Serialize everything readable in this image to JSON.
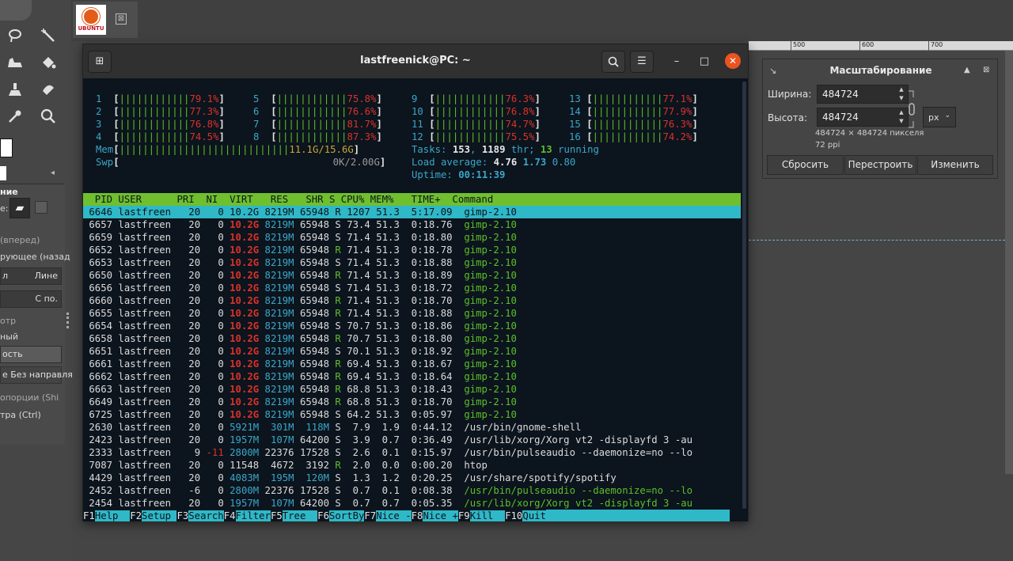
{
  "gimp": {
    "tool_options": {
      "title": "ние",
      "mode_label": "е:",
      "lines": [
        "(вперед)",
        "рующее (назад",
        "отр",
        "ный",
        "ость",
        "опорции (Shi",
        "тра (Ctrl)"
      ],
      "box1_left": "л",
      "box1_right": "Лине",
      "box2_right": "С по.",
      "box3_text": "е Без направля"
    },
    "image_tab": {
      "thumb_text": "UBUNTU",
      "close": "⊠"
    },
    "ruler": [
      "500",
      "600",
      "700"
    ]
  },
  "scale_dialog": {
    "title": "Масштабирование",
    "width_label": "Ширина:",
    "width_value": "484724",
    "height_label": "Высота:",
    "height_value": "484724",
    "unit": "px",
    "size_info": "484724 × 484724 пикселя",
    "resolution_info": "72 ppi",
    "reset_button": "Сбросить",
    "rebuild_button": "Перестроить",
    "change_button": "Изменить"
  },
  "terminal": {
    "title": "lastfreenick@PC: ~",
    "cpus": [
      {
        "n": "1",
        "bar": "||||||||||||",
        "pct": "79.1%"
      },
      {
        "n": "2",
        "bar": "||||||||||||",
        "pct": "77.3%"
      },
      {
        "n": "3",
        "bar": "||||||||||||",
        "pct": "76.8%"
      },
      {
        "n": "4",
        "bar": "||||||||||||",
        "pct": "74.5%"
      },
      {
        "n": "5",
        "bar": "||||||||||||",
        "pct": "75.8%"
      },
      {
        "n": "6",
        "bar": "||||||||||||",
        "pct": "76.6%"
      },
      {
        "n": "7",
        "bar": "||||||||||||",
        "pct": "81.7%"
      },
      {
        "n": "8",
        "bar": "||||||||||||",
        "pct": "87.3%"
      },
      {
        "n": "9",
        "bar": "||||||||||||",
        "pct": "76.3%"
      },
      {
        "n": "10",
        "bar": "||||||||||||",
        "pct": "76.8%"
      },
      {
        "n": "11",
        "bar": "||||||||||||",
        "pct": "74.7%"
      },
      {
        "n": "12",
        "bar": "||||||||||||",
        "pct": "75.5%"
      },
      {
        "n": "13",
        "bar": "||||||||||||",
        "pct": "77.1%"
      },
      {
        "n": "14",
        "bar": "||||||||||||",
        "pct": "77.9%"
      },
      {
        "n": "15",
        "bar": "||||||||||||",
        "pct": "76.3%"
      },
      {
        "n": "16",
        "bar": "||||||||||||",
        "pct": "74.2%"
      }
    ],
    "mem_label": "Mem",
    "mem_bar": "|||||||||||||||||||||||||||||",
    "mem_value": "11.1G/15.6G",
    "swp_label": "Swp",
    "swp_value": "0K/2.00G",
    "tasks_label": "Tasks: ",
    "tasks_total": "153",
    "tasks_thr": "1189",
    "tasks_running": "13",
    "load_label": "Load average: ",
    "load1": "4.76",
    "load5": "1.73",
    "load15": "0.80",
    "uptime_label": "Uptime: ",
    "uptime": "00:11:39",
    "header": "  PID USER      PRI  NI  VIRT   RES   SHR S CPU% MEM%   TIME+  Command",
    "processes": [
      {
        "pid": "6646",
        "user": "lastfreen",
        "pri": "20",
        "ni": "0",
        "virt": "10.2G",
        "res": "8219M",
        "shr": "65948",
        "s": "R",
        "cpu": "1207",
        "mem": "51.3",
        "time": "5:17.09",
        "cmd": "gimp-2.10",
        "selected": true
      },
      {
        "pid": "6657",
        "user": "lastfreen",
        "pri": "20",
        "ni": "0",
        "virt": "10.2G",
        "res": "8219M",
        "shr": "65948",
        "s": "S",
        "cpu": "73.4",
        "mem": "51.3",
        "time": "0:18.76",
        "cmd": "gimp-2.10"
      },
      {
        "pid": "6659",
        "user": "lastfreen",
        "pri": "20",
        "ni": "0",
        "virt": "10.2G",
        "res": "8219M",
        "shr": "65948",
        "s": "S",
        "cpu": "71.4",
        "mem": "51.3",
        "time": "0:18.80",
        "cmd": "gimp-2.10"
      },
      {
        "pid": "6652",
        "user": "lastfreen",
        "pri": "20",
        "ni": "0",
        "virt": "10.2G",
        "res": "8219M",
        "shr": "65948",
        "s": "R",
        "cpu": "71.4",
        "mem": "51.3",
        "time": "0:18.78",
        "cmd": "gimp-2.10"
      },
      {
        "pid": "6653",
        "user": "lastfreen",
        "pri": "20",
        "ni": "0",
        "virt": "10.2G",
        "res": "8219M",
        "shr": "65948",
        "s": "S",
        "cpu": "71.4",
        "mem": "51.3",
        "time": "0:18.88",
        "cmd": "gimp-2.10"
      },
      {
        "pid": "6650",
        "user": "lastfreen",
        "pri": "20",
        "ni": "0",
        "virt": "10.2G",
        "res": "8219M",
        "shr": "65948",
        "s": "R",
        "cpu": "71.4",
        "mem": "51.3",
        "time": "0:18.89",
        "cmd": "gimp-2.10"
      },
      {
        "pid": "6656",
        "user": "lastfreen",
        "pri": "20",
        "ni": "0",
        "virt": "10.2G",
        "res": "8219M",
        "shr": "65948",
        "s": "S",
        "cpu": "71.4",
        "mem": "51.3",
        "time": "0:18.72",
        "cmd": "gimp-2.10"
      },
      {
        "pid": "6660",
        "user": "lastfreen",
        "pri": "20",
        "ni": "0",
        "virt": "10.2G",
        "res": "8219M",
        "shr": "65948",
        "s": "R",
        "cpu": "71.4",
        "mem": "51.3",
        "time": "0:18.70",
        "cmd": "gimp-2.10"
      },
      {
        "pid": "6655",
        "user": "lastfreen",
        "pri": "20",
        "ni": "0",
        "virt": "10.2G",
        "res": "8219M",
        "shr": "65948",
        "s": "R",
        "cpu": "71.4",
        "mem": "51.3",
        "time": "0:18.88",
        "cmd": "gimp-2.10"
      },
      {
        "pid": "6654",
        "user": "lastfreen",
        "pri": "20",
        "ni": "0",
        "virt": "10.2G",
        "res": "8219M",
        "shr": "65948",
        "s": "S",
        "cpu": "70.7",
        "mem": "51.3",
        "time": "0:18.86",
        "cmd": "gimp-2.10"
      },
      {
        "pid": "6658",
        "user": "lastfreen",
        "pri": "20",
        "ni": "0",
        "virt": "10.2G",
        "res": "8219M",
        "shr": "65948",
        "s": "R",
        "cpu": "70.7",
        "mem": "51.3",
        "time": "0:18.80",
        "cmd": "gimp-2.10"
      },
      {
        "pid": "6651",
        "user": "lastfreen",
        "pri": "20",
        "ni": "0",
        "virt": "10.2G",
        "res": "8219M",
        "shr": "65948",
        "s": "S",
        "cpu": "70.1",
        "mem": "51.3",
        "time": "0:18.92",
        "cmd": "gimp-2.10"
      },
      {
        "pid": "6661",
        "user": "lastfreen",
        "pri": "20",
        "ni": "0",
        "virt": "10.2G",
        "res": "8219M",
        "shr": "65948",
        "s": "R",
        "cpu": "69.4",
        "mem": "51.3",
        "time": "0:18.67",
        "cmd": "gimp-2.10"
      },
      {
        "pid": "6662",
        "user": "lastfreen",
        "pri": "20",
        "ni": "0",
        "virt": "10.2G",
        "res": "8219M",
        "shr": "65948",
        "s": "R",
        "cpu": "69.4",
        "mem": "51.3",
        "time": "0:18.64",
        "cmd": "gimp-2.10"
      },
      {
        "pid": "6663",
        "user": "lastfreen",
        "pri": "20",
        "ni": "0",
        "virt": "10.2G",
        "res": "8219M",
        "shr": "65948",
        "s": "R",
        "cpu": "68.8",
        "mem": "51.3",
        "time": "0:18.43",
        "cmd": "gimp-2.10"
      },
      {
        "pid": "6649",
        "user": "lastfreen",
        "pri": "20",
        "ni": "0",
        "virt": "10.2G",
        "res": "8219M",
        "shr": "65948",
        "s": "R",
        "cpu": "68.8",
        "mem": "51.3",
        "time": "0:18.70",
        "cmd": "gimp-2.10"
      },
      {
        "pid": "6725",
        "user": "lastfreen",
        "pri": "20",
        "ni": "0",
        "virt": "10.2G",
        "res": "8219M",
        "shr": "65948",
        "s": "S",
        "cpu": "64.2",
        "mem": "51.3",
        "time": "0:05.97",
        "cmd": "gimp-2.10"
      },
      {
        "pid": "2630",
        "user": "lastfreen",
        "pri": "20",
        "ni": "0",
        "virt": "5921M",
        "res": "301M",
        "shr": "118M",
        "s": "S",
        "cpu": "7.9",
        "mem": "1.9",
        "time": "0:44.12",
        "cmd": "/usr/bin/gnome-shell"
      },
      {
        "pid": "2423",
        "user": "lastfreen",
        "pri": "20",
        "ni": "0",
        "virt": "1957M",
        "res": "107M",
        "shr": "64200",
        "s": "S",
        "cpu": "3.9",
        "mem": "0.7",
        "time": "0:36.49",
        "cmd": "/usr/lib/xorg/Xorg vt2 -displayfd 3 -au"
      },
      {
        "pid": "2333",
        "user": "lastfreen",
        "pri": "9",
        "ni": "-11",
        "virt": "2800M",
        "res": "22376",
        "shr": "17528",
        "s": "S",
        "cpu": "2.6",
        "mem": "0.1",
        "time": "0:15.97",
        "cmd": "/usr/bin/pulseaudio --daemonize=no --lo"
      },
      {
        "pid": "7087",
        "user": "lastfreen",
        "pri": "20",
        "ni": "0",
        "virt": "11548",
        "res": "4672",
        "shr": "3192",
        "s": "R",
        "cpu": "2.0",
        "mem": "0.0",
        "time": "0:00.20",
        "cmd": "htop"
      },
      {
        "pid": "4429",
        "user": "lastfreen",
        "pri": "20",
        "ni": "0",
        "virt": "4083M",
        "res": "195M",
        "shr": "120M",
        "s": "S",
        "cpu": "1.3",
        "mem": "1.2",
        "time": "0:20.25",
        "cmd": "/usr/share/spotify/spotify"
      },
      {
        "pid": "2452",
        "user": "lastfreen",
        "pri": "-6",
        "ni": "0",
        "virt": "2800M",
        "res": "22376",
        "shr": "17528",
        "s": "S",
        "cpu": "0.7",
        "mem": "0.1",
        "time": "0:08.38",
        "cmd": "/usr/bin/pulseaudio --daemonize=no --lo"
      },
      {
        "pid": "2454",
        "user": "lastfreen",
        "pri": "20",
        "ni": "0",
        "virt": "1957M",
        "res": "107M",
        "shr": "64200",
        "s": "S",
        "cpu": "0.7",
        "mem": "0.7",
        "time": "0:05.35",
        "cmd": "/usr/lib/xorg/Xorg vt2 -displayfd 3 -au"
      }
    ],
    "fkeys": [
      {
        "key": "F1",
        "label": "Help  "
      },
      {
        "key": "F2",
        "label": "Setup "
      },
      {
        "key": "F3",
        "label": "Search"
      },
      {
        "key": "F4",
        "label": "Filter"
      },
      {
        "key": "F5",
        "label": "Tree  "
      },
      {
        "key": "F6",
        "label": "SortBy"
      },
      {
        "key": "F7",
        "label": "Nice -"
      },
      {
        "key": "F8",
        "label": "Nice +"
      },
      {
        "key": "F9",
        "label": "Kill  "
      },
      {
        "key": "F10",
        "label": "Quit"
      }
    ]
  },
  "colors": {
    "accent": "#e95420",
    "htop_green": "#6fbf2e",
    "htop_cyan": "#2fb8c7",
    "htop_red": "#d9322b"
  }
}
